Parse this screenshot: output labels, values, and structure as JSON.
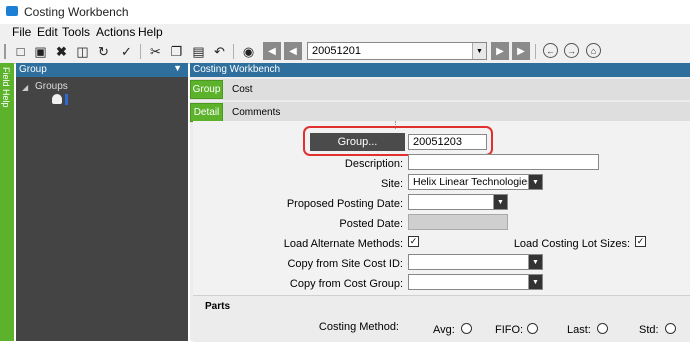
{
  "window": {
    "title": "Costing Workbench"
  },
  "menu": [
    "File",
    "Edit",
    "Tools",
    "Actions",
    "Help"
  ],
  "toolbar": {
    "key_value": "20051201",
    "icons": [
      "new-icon",
      "save-icon",
      "delete-icon",
      "attach-icon",
      "refresh-icon",
      "clear-icon",
      "cut-icon",
      "copy-icon",
      "paste-icon",
      "undo-icon",
      "binoculars-icon",
      "first-icon",
      "prev-icon",
      "next-icon",
      "last-icon",
      "back-icon",
      "forward-icon",
      "home-icon"
    ]
  },
  "field_help": {
    "label": "Field Help"
  },
  "tree": {
    "header": "Group",
    "pin": "▼",
    "node_label": "Groups"
  },
  "main": {
    "header": "Costing Workbench",
    "tabs": [
      {
        "tab": "Group",
        "label": "Cost"
      },
      {
        "tab": "Detail",
        "label": "Comments"
      }
    ]
  },
  "form": {
    "group_button_label": "Group...",
    "group_value": "20051203",
    "description_label": "Description:",
    "description_value": "",
    "site_label": "Site:",
    "site_value": "Helix Linear Technologies",
    "proposed_posting_date_label": "Proposed Posting Date:",
    "proposed_posting_date_value": "",
    "posted_date_label": "Posted Date:",
    "posted_date_value": "",
    "load_alternate_methods_label": "Load Alternate Methods:",
    "load_alternate_methods_checked": true,
    "load_costing_lot_sizes_label": "Load Costing Lot Sizes:",
    "load_costing_lot_sizes_checked": true,
    "copy_site_cost_id_label": "Copy from Site Cost ID:",
    "copy_site_cost_id_value": "",
    "copy_cost_group_label": "Copy from Cost Group:",
    "copy_cost_group_value": ""
  },
  "parts": {
    "title": "Parts",
    "costing_method_label": "Costing Method:",
    "options": [
      "Avg:",
      "FIFO:",
      "Last:",
      "Std:"
    ]
  },
  "colors": {
    "accent_green": "#5cb32b",
    "header_blue": "#2e6f9e",
    "highlight_red": "#e03030"
  }
}
